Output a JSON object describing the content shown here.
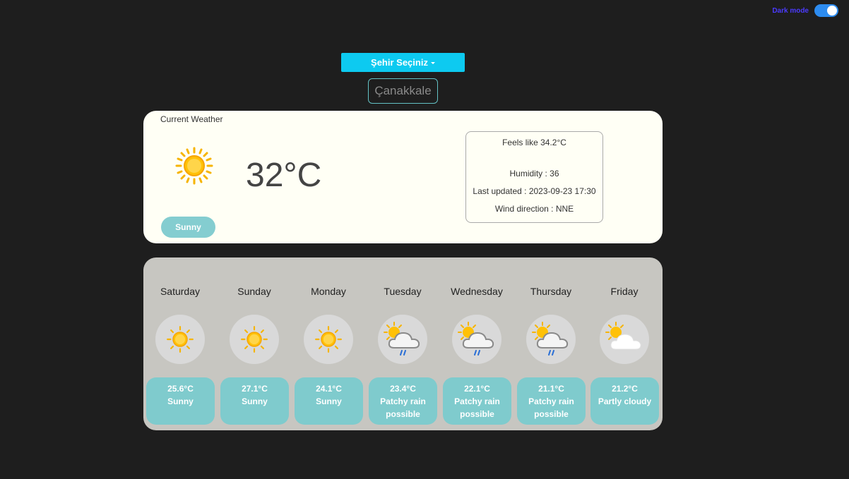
{
  "dark_mode": {
    "label": "Dark mode",
    "enabled": true
  },
  "city_select": {
    "label": "Şehir Seçiniz"
  },
  "city_name": "Çanakkale",
  "current": {
    "heading": "Current Weather",
    "temperature": "32°C",
    "condition": "Sunny",
    "icon": "sun-icon",
    "feels_like": "Feels like 34.2°C",
    "humidity": "Humidity : 36",
    "last_updated": "Last updated : 2023-09-23 17:30",
    "wind_direction": "Wind direction : NNE"
  },
  "forecast": [
    {
      "day": "Saturday",
      "temp": "25.6°C",
      "condition": "Sunny",
      "icon": "sun-icon"
    },
    {
      "day": "Sunday",
      "temp": "27.1°C",
      "condition": "Sunny",
      "icon": "sun-icon"
    },
    {
      "day": "Monday",
      "temp": "24.1°C",
      "condition": "Sunny",
      "icon": "sun-icon"
    },
    {
      "day": "Tuesday",
      "temp": "23.4°C",
      "condition": "Patchy rain possible",
      "icon": "rain-cloud-icon"
    },
    {
      "day": "Wednesday",
      "temp": "22.1°C",
      "condition": "Patchy rain possible",
      "icon": "rain-cloud-icon"
    },
    {
      "day": "Thursday",
      "temp": "21.1°C",
      "condition": "Patchy rain possible",
      "icon": "rain-cloud-icon"
    },
    {
      "day": "Friday",
      "temp": "21.2°C",
      "condition": "Partly cloudy",
      "icon": "partly-cloudy-icon"
    }
  ],
  "colors": {
    "background": "#1e1e1e",
    "accent": "#0dcaf0",
    "pill": "#7fcbcd",
    "card": "#fffff5",
    "forecast_panel": "#c7c6c1",
    "toggle": "#2d8cf0"
  }
}
